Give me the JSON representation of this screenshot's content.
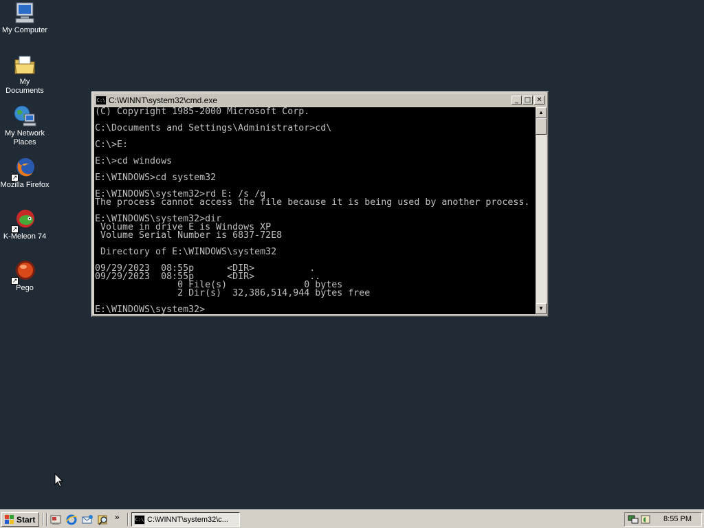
{
  "desktop": {
    "icons": [
      {
        "label": "My Computer",
        "icon": "my-computer-icon"
      },
      {
        "label": "My Documents",
        "icon": "my-documents-icon"
      },
      {
        "label": "My Network Places",
        "icon": "my-network-places-icon"
      },
      {
        "label": "Mozilla Firefox",
        "icon": "firefox-icon"
      },
      {
        "label": "K-Meleon 74",
        "icon": "k-meleon-icon"
      },
      {
        "label": "Pego",
        "icon": "pego-icon"
      }
    ]
  },
  "window": {
    "title": "C:\\WINNT\\system32\\cmd.exe",
    "title_icon_text": "C:\\",
    "minimize_label": "_",
    "maximize_label": "□",
    "close_label": "✕",
    "scroll_up": "▲",
    "scroll_down": "▼",
    "console_lines": [
      "(C) Copyright 1985-2000 Microsoft Corp.",
      "",
      "C:\\Documents and Settings\\Administrator>cd\\",
      "",
      "C:\\>E:",
      "",
      "E:\\>cd windows",
      "",
      "E:\\WINDOWS>cd system32",
      "",
      "E:\\WINDOWS\\system32>rd E: /s /q",
      "The process cannot access the file because it is being used by another process.",
      "",
      "E:\\WINDOWS\\system32>dir",
      " Volume in drive E is Windows XP",
      " Volume Serial Number is 6837-72E8",
      "",
      " Directory of E:\\WINDOWS\\system32",
      "",
      "09/29/2023  08:55p      <DIR>          .",
      "09/29/2023  08:55p      <DIR>          ..",
      "               0 File(s)              0 bytes",
      "               2 Dir(s)  32,386,514,944 bytes free",
      "",
      "E:\\WINDOWS\\system32>"
    ]
  },
  "taskbar": {
    "start_label": "Start",
    "quicklaunch": [
      "show-desktop-icon",
      "internet-explorer-icon",
      "outlook-express-icon",
      "search-icon"
    ],
    "more_label": "»",
    "task_label": "C:\\WINNT\\system32\\c...",
    "clock": "8:55 PM"
  },
  "colors": {
    "desktop": "#212b35",
    "console_bg": "#000000",
    "console_fg": "#c0c0c0"
  }
}
